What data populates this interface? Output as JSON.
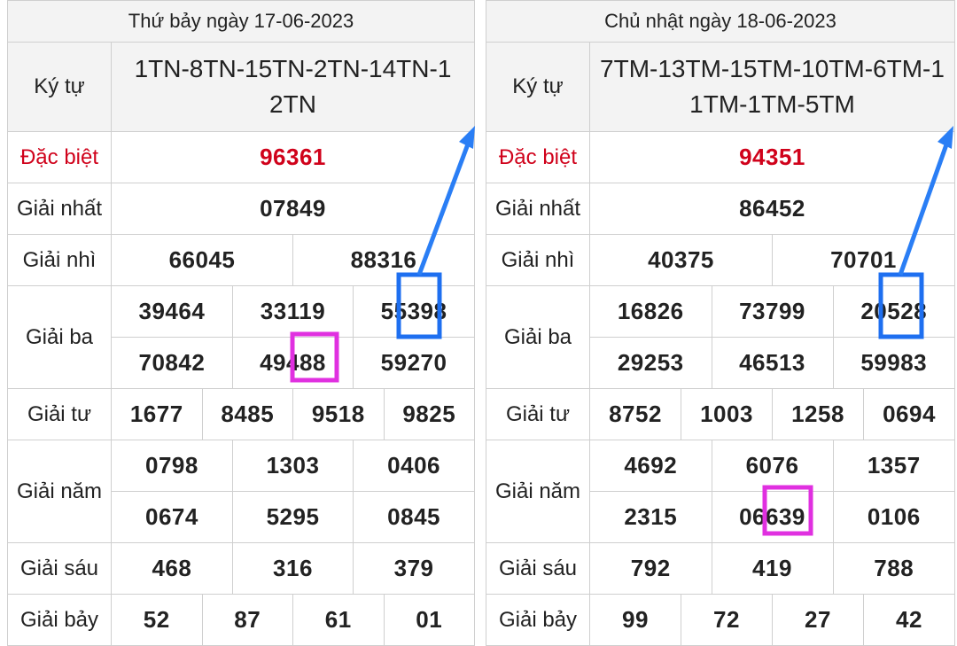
{
  "left": {
    "date": "Thứ bảy ngày 17-06-2023",
    "labels": {
      "kytu": "Ký tự",
      "db": "Đặc biệt",
      "g1": "Giải nhất",
      "g2": "Giải nhì",
      "g3": "Giải ba",
      "g4": "Giải tư",
      "g5": "Giải năm",
      "g6": "Giải sáu",
      "g7": "Giải bảy"
    },
    "kytu": "1TN-8TN-15TN-2TN-14TN-12TN",
    "db": "96361",
    "g1": "07849",
    "g2": [
      "66045",
      "88316"
    ],
    "g3": [
      "39464",
      "33119",
      "55398",
      "70842",
      "49488",
      "59270"
    ],
    "g4": [
      "1677",
      "8485",
      "9518",
      "9825"
    ],
    "g5": [
      "0798",
      "1303",
      "0406",
      "0674",
      "5295",
      "0845"
    ],
    "g6": [
      "468",
      "316",
      "379"
    ],
    "g7": [
      "52",
      "87",
      "61",
      "01"
    ]
  },
  "right": {
    "date": "Chủ nhật ngày 18-06-2023",
    "labels": {
      "kytu": "Ký tự",
      "db": "Đặc biệt",
      "g1": "Giải nhất",
      "g2": "Giải nhì",
      "g3": "Giải ba",
      "g4": "Giải tư",
      "g5": "Giải năm",
      "g6": "Giải sáu",
      "g7": "Giải bảy"
    },
    "kytu": "7TM-13TM-15TM-10TM-6TM-11TM-1TM-5TM",
    "db": "94351",
    "g1": "86452",
    "g2": [
      "40375",
      "70701"
    ],
    "g3": [
      "16826",
      "73799",
      "20528",
      "29253",
      "46513",
      "59983"
    ],
    "g4": [
      "8752",
      "1003",
      "1258",
      "0694"
    ],
    "g5": [
      "4692",
      "6076",
      "1357",
      "2315",
      "06639",
      "0106"
    ],
    "g6": [
      "792",
      "419",
      "788"
    ],
    "g7": [
      "99",
      "72",
      "27",
      "42"
    ]
  },
  "colors": {
    "special": "#d0021b",
    "highlight_blue": "#1e6ff0",
    "highlight_magenta": "#e030e0",
    "arrow": "#2a7ef5"
  }
}
